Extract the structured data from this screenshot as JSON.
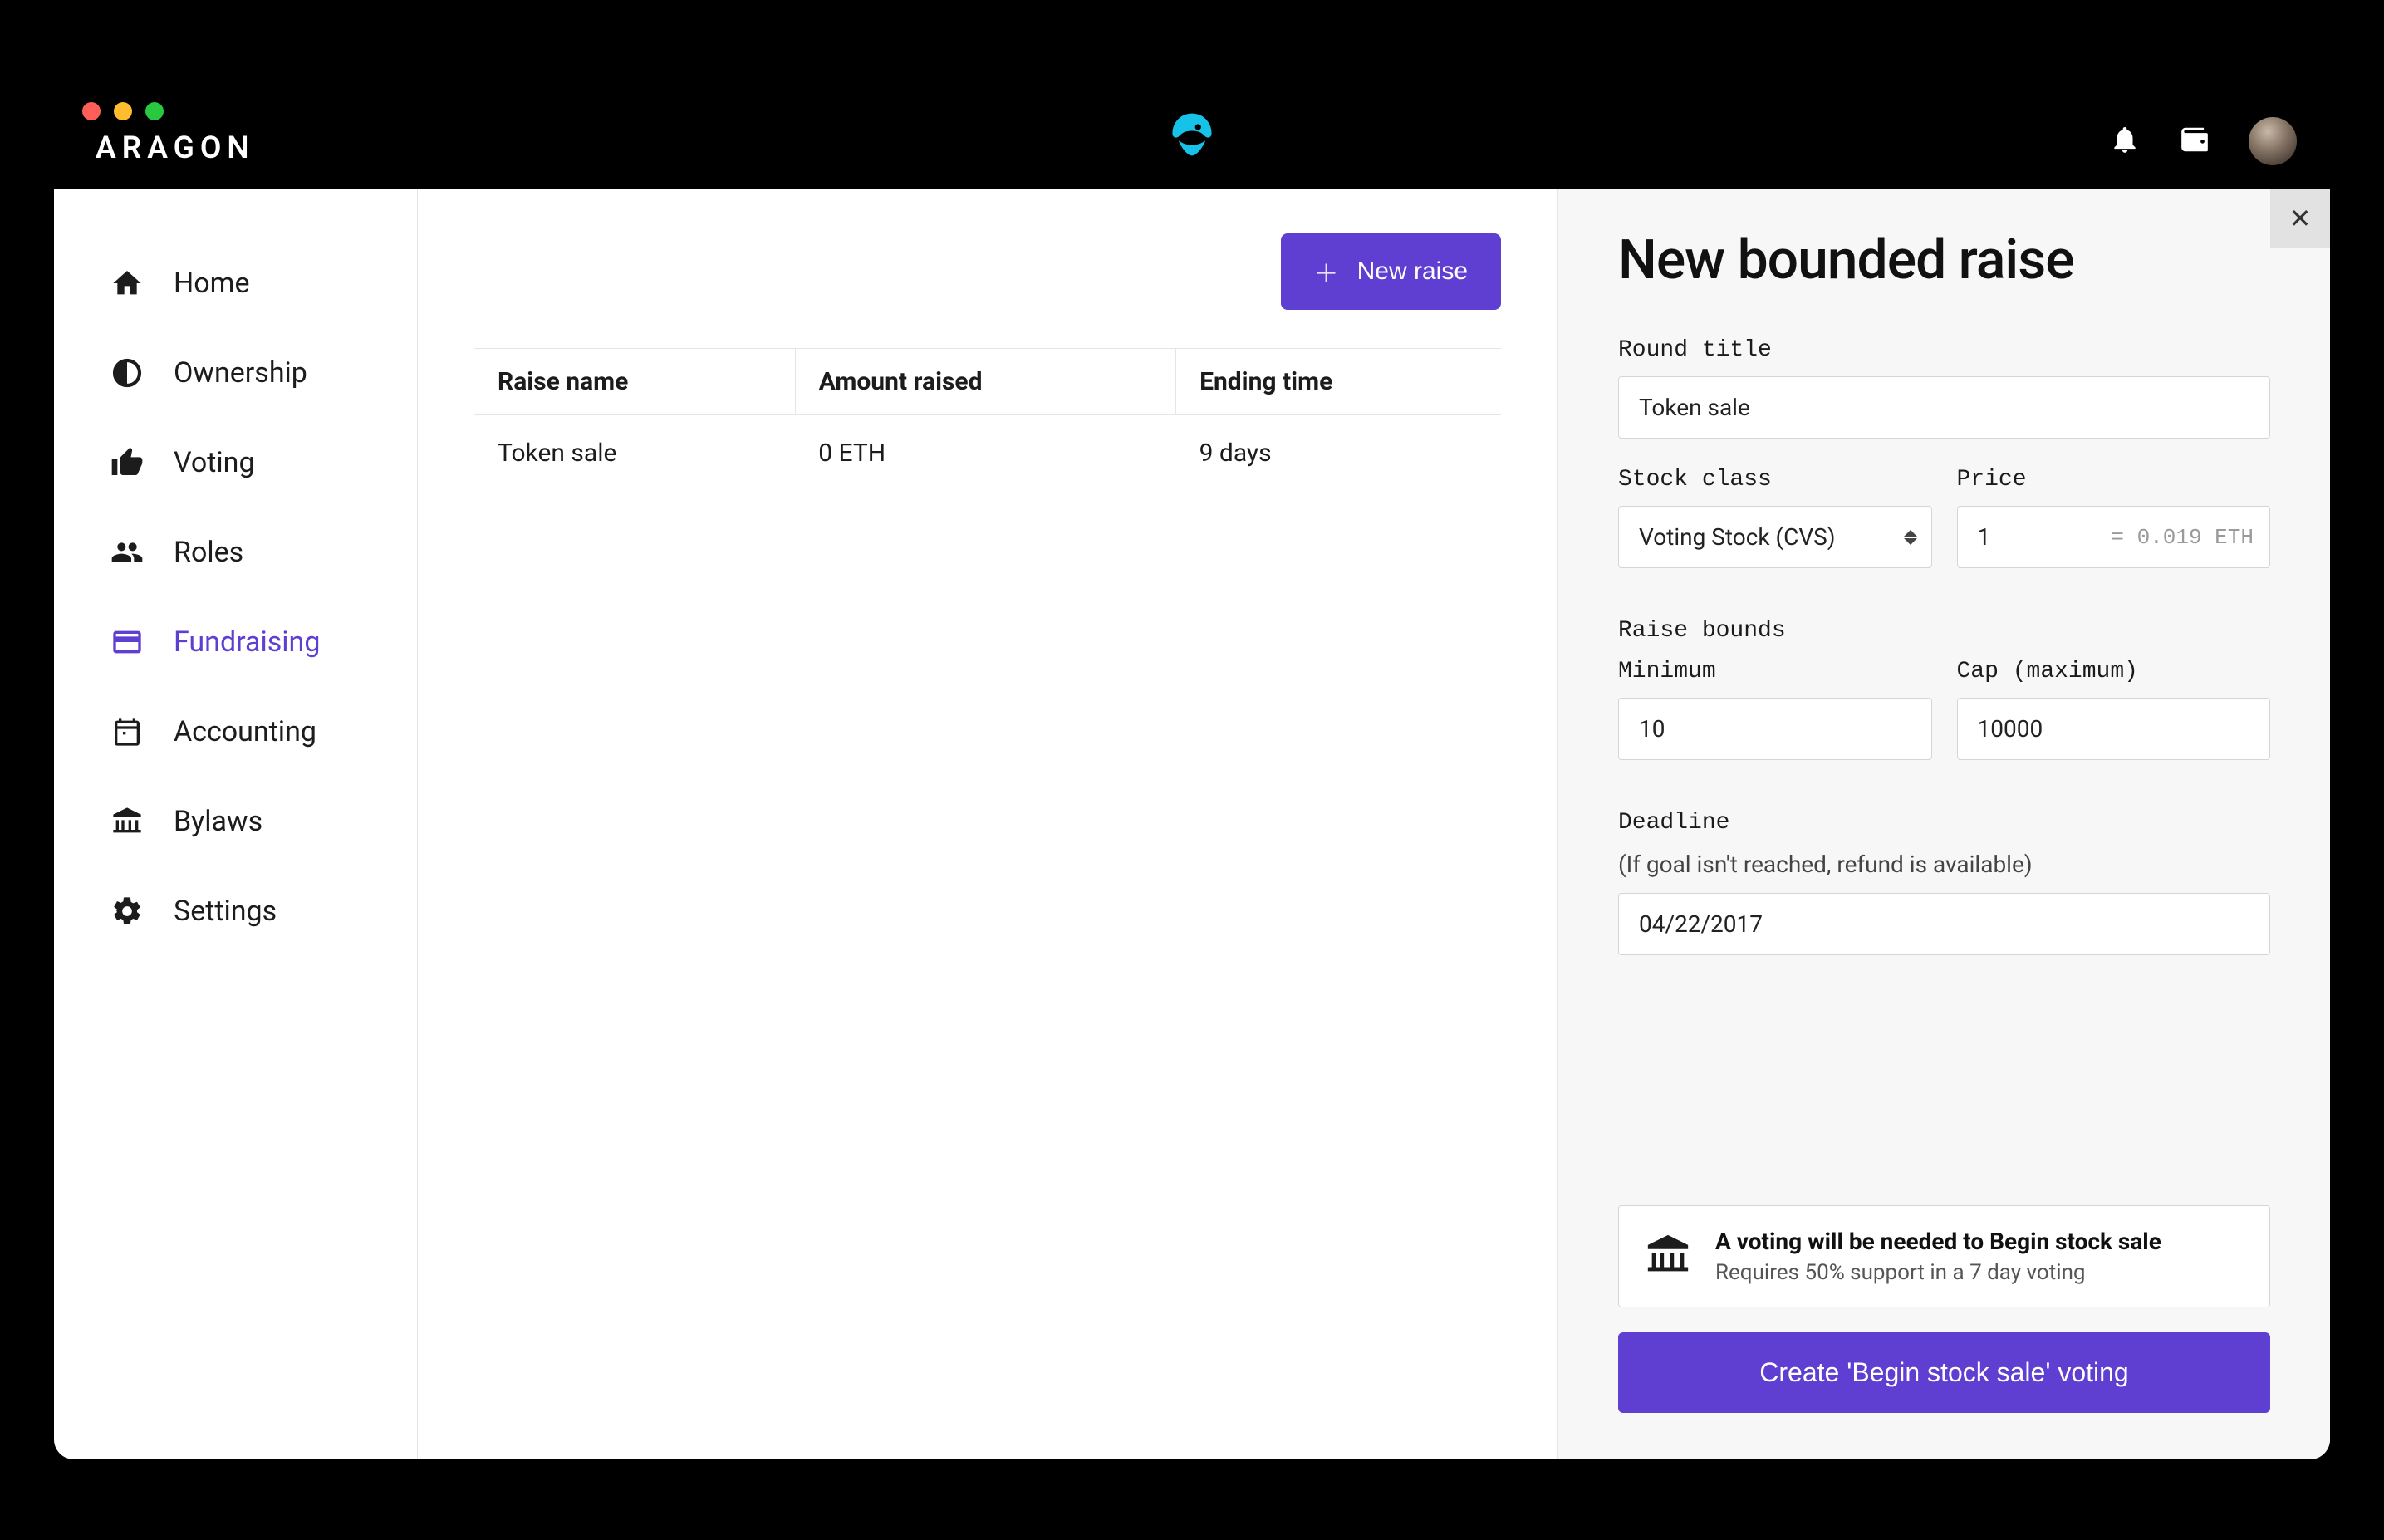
{
  "brand": "ARAGON",
  "sidebar": {
    "items": [
      {
        "label": "Home"
      },
      {
        "label": "Ownership"
      },
      {
        "label": "Voting"
      },
      {
        "label": "Roles"
      },
      {
        "label": "Fundraising"
      },
      {
        "label": "Accounting"
      },
      {
        "label": "Bylaws"
      },
      {
        "label": "Settings"
      }
    ],
    "active_index": 4
  },
  "main": {
    "new_raise_label": "New raise",
    "columns": [
      "Raise name",
      "Amount raised",
      "Ending time"
    ],
    "rows": [
      {
        "name": "Token sale",
        "amount": "0 ETH",
        "ending": "9 days"
      }
    ]
  },
  "panel": {
    "title": "New bounded raise",
    "labels": {
      "round_title": "Round title",
      "stock_class": "Stock class",
      "price": "Price",
      "raise_bounds": "Raise bounds",
      "minimum": "Minimum",
      "cap": "Cap (maximum)",
      "deadline": "Deadline",
      "deadline_hint": "(If goal isn't reached, refund is available)"
    },
    "values": {
      "round_title": "Token sale",
      "stock_class": "Voting Stock (CVS)",
      "price": "1",
      "price_eq": "= 0.019 ETH",
      "minimum": "10",
      "cap": "10000",
      "deadline": "04/22/2017"
    },
    "notice": {
      "title": "A voting will be needed to Begin stock sale",
      "body": "Requires 50% support in a 7 day voting"
    },
    "submit_label": "Create 'Begin stock sale' voting"
  }
}
